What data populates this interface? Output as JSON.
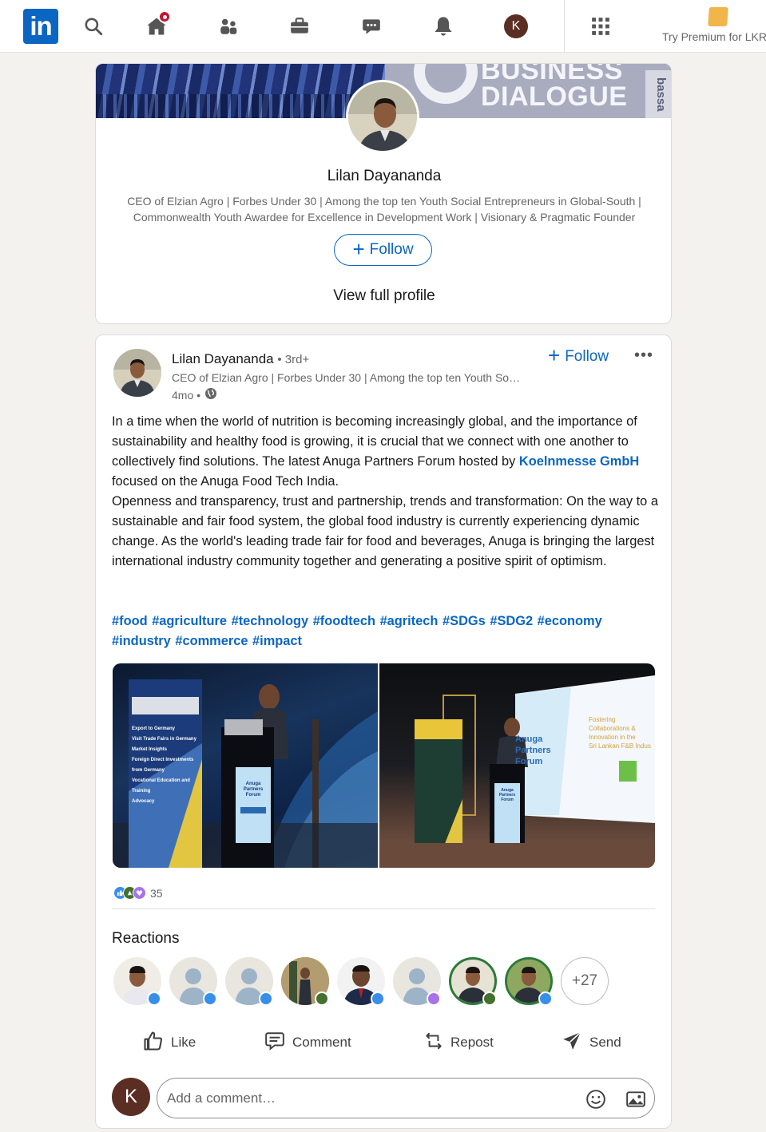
{
  "nav": {
    "logo_text": "in",
    "notifications_badge_icon": "dot",
    "me_initial": "K",
    "premium_label": "Try Premium for LKR",
    "icons": [
      "search-icon",
      "home-icon",
      "my-network-icon",
      "jobs-icon",
      "messaging-icon",
      "notifications-icon",
      "apps-grid-icon",
      "premium-icon"
    ]
  },
  "profile_card": {
    "banner_text_line1": "BUSINESS",
    "banner_text_line2": "DIALOGUE",
    "banner_side_text": "bassa",
    "name": "Lilan Dayananda",
    "headline": "CEO of Elzian Agro | Forbes Under 30 | Among the top ten Youth Social Entrepreneurs in Global-South | Commonwealth Youth Awardee for Excellence in Development Work | Visionary & Pragmatic Founder",
    "follow_label": "Follow",
    "follow_plus": "+",
    "view_profile_label": "View full profile"
  },
  "post": {
    "author": "Lilan Dayananda",
    "degree": "• 3rd+",
    "headline": "CEO of Elzian Agro | Forbes Under 30 | Among the top ten Youth So…",
    "time": "4mo •",
    "follow_label": "Follow",
    "follow_plus": "+",
    "more_label": "•••",
    "body_part1": "In a time when the world of nutrition is becoming increasingly global, and the importance of sustainability and healthy food is growing, it is crucial that we connect with one another to collectively find solutions. The latest Anuga Partners Forum hosted by ",
    "mention": "Koelnmesse GmbH",
    "body_part2": " focused on the Anuga Food Tech India.",
    "body_paragraph2": "Openness and transparency, trust and partnership, trends and transformation: On the way to a sustainable and fair food system, the global food industry is currently experiencing dynamic change. As the world's leading trade fair for food and beverages, Anuga is bringing the largest international industry community together and generating a positive spirit of optimism.",
    "hashtags": [
      "#food",
      "#agriculture",
      "#technology",
      "#foodtech",
      "#agritech",
      "#SDGs",
      "#SDG2",
      "#economy",
      "#industry",
      "#commerce",
      "#impact"
    ],
    "photo1": {
      "banner_lines": [
        "Export to Germany",
        "Visit Trade Fairs in Germany",
        "Market Insights",
        "Foreign Direct Investments from Germany",
        "Vocational Education and Training",
        "Advocacy"
      ],
      "podium_lines": [
        "Anuga",
        "Partners",
        "Forum"
      ]
    },
    "photo2": {
      "screen_lines": [
        "Fostering",
        "Collaborations &",
        "Innovation in the",
        "Sri Lankan F&B Indus"
      ],
      "screen_brand": "Anuga Partners Forum",
      "podium_lines": [
        "Anuga",
        "Partners",
        "Forum"
      ]
    },
    "reaction_count": "35",
    "reactions_title": "Reactions",
    "more_reactors": "+27",
    "actions": {
      "like": "Like",
      "comment": "Comment",
      "repost": "Repost",
      "send": "Send"
    },
    "comment_avatar_initial": "K",
    "comment_placeholder": "Add a comment…",
    "colors": {
      "link_blue": "#0a66c2",
      "like_blue": "#378fe9",
      "support_purple": "#a872e8",
      "celebrate_green": "#44712e"
    }
  }
}
